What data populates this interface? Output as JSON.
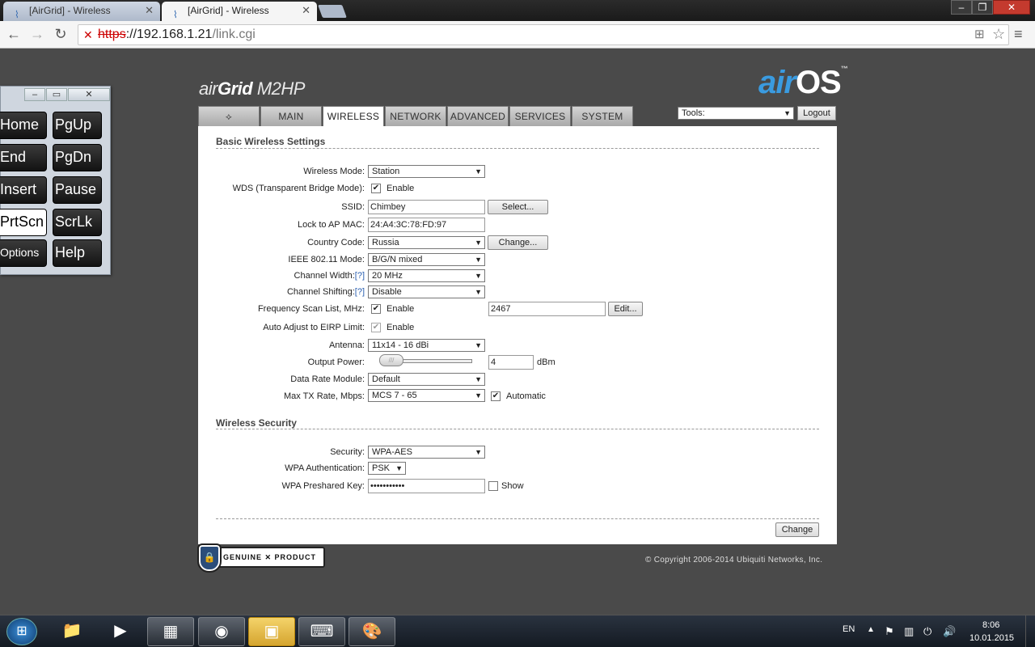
{
  "browser": {
    "tabs": [
      {
        "title": "[AirGrid] - Wireless"
      },
      {
        "title": "[AirGrid] - Wireless"
      }
    ],
    "url": {
      "scheme": "https",
      "host": "://192.168.1.21",
      "path": "/link.cgi"
    }
  },
  "osk": {
    "keys": [
      "Home",
      "PgUp",
      "End",
      "PgDn",
      "Insert",
      "Pause",
      "PrtScn",
      "ScrLk",
      "Options",
      "Help"
    ]
  },
  "header": {
    "brand_prefix": "air",
    "brand_grid": "Grid",
    "brand_model": "M2HP",
    "airos_air": "air",
    "airos_os": "OS",
    "airos_tm": "™",
    "tools_label": "Tools:",
    "logout_label": "Logout"
  },
  "nav": {
    "tabs": [
      "MAIN",
      "WIRELESS",
      "NETWORK",
      "ADVANCED",
      "SERVICES",
      "SYSTEM"
    ],
    "active": "WIRELESS"
  },
  "basic": {
    "title": "Basic Wireless Settings",
    "wireless_mode_label": "Wireless Mode:",
    "wireless_mode_value": "Station",
    "wds_label": "WDS (Transparent Bridge Mode):",
    "wds_enable": "Enable",
    "ssid_label": "SSID:",
    "ssid_value": "Chimbey",
    "select_btn": "Select...",
    "lock_mac_label": "Lock to AP MAC:",
    "lock_mac_value": "24:A4:3C:78:FD:97",
    "country_label": "Country Code:",
    "country_value": "Russia",
    "change_country_btn": "Change...",
    "ieee_label": "IEEE 802.11 Mode:",
    "ieee_value": "B/G/N mixed",
    "channel_width_label": "Channel Width:",
    "channel_width_value": "20 MHz",
    "channel_shift_label": "Channel Shifting:",
    "channel_shift_value": "Disable",
    "help_marker": "[?]",
    "freq_scan_label": "Frequency Scan List, MHz:",
    "freq_scan_enable": "Enable",
    "freq_scan_value": "2467",
    "edit_btn": "Edit...",
    "auto_eirp_label": "Auto Adjust to EIRP Limit:",
    "auto_eirp_enable": "Enable",
    "antenna_label": "Antenna:",
    "antenna_value": "11x14 - 16 dBi",
    "output_power_label": "Output Power:",
    "output_power_value": "4",
    "output_power_unit": "dBm",
    "data_rate_label": "Data Rate Module:",
    "data_rate_value": "Default",
    "max_tx_label": "Max TX Rate, Mbps:",
    "max_tx_value": "MCS 7 - 65",
    "max_tx_auto": "Automatic"
  },
  "security": {
    "title": "Wireless Security",
    "security_label": "Security:",
    "security_value": "WPA-AES",
    "wpa_auth_label": "WPA Authentication:",
    "wpa_auth_value": "PSK",
    "wpa_key_label": "WPA Preshared Key:",
    "wpa_key_value": "•••••••••••",
    "show_label": "Show"
  },
  "footer": {
    "change_btn": "Change",
    "genuine_text": "GENUINE ✕ PRODUCT",
    "copyright": "© Copyright 2006-2014 Ubiquiti Networks, Inc."
  },
  "taskbar": {
    "lang": "EN",
    "time": "8:06",
    "date": "10.01.2015"
  }
}
